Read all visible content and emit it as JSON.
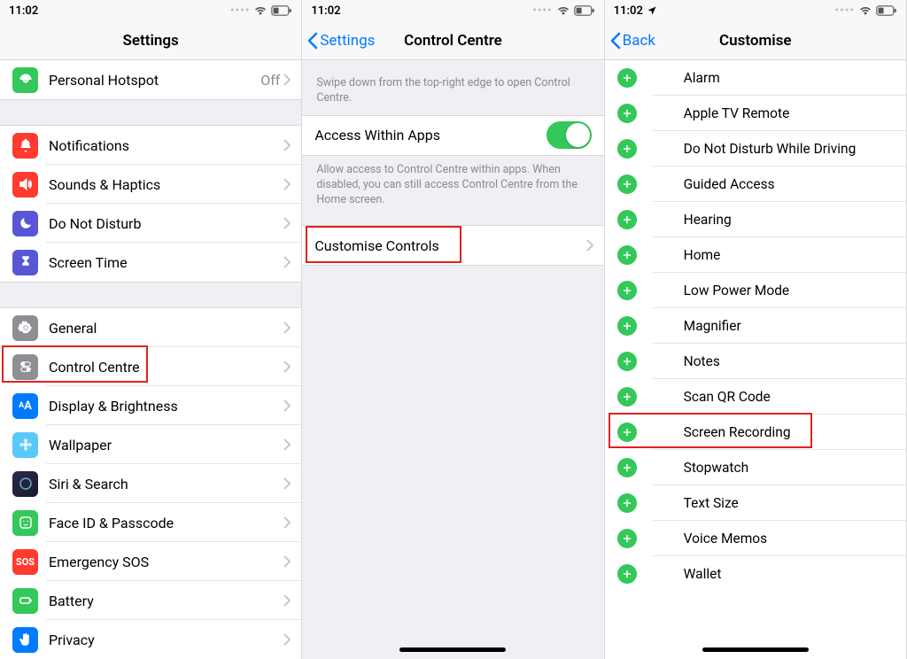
{
  "status": {
    "time": "11:02",
    "locationArrow": "↗"
  },
  "screen1": {
    "title": "Settings",
    "hotspot": {
      "label": "Personal Hotspot",
      "value": "Off"
    },
    "groupA": [
      {
        "label": "Notifications",
        "color": "red",
        "icon": "bell"
      },
      {
        "label": "Sounds & Haptics",
        "color": "red",
        "icon": "speaker"
      },
      {
        "label": "Do Not Disturb",
        "color": "purple",
        "icon": "moon"
      },
      {
        "label": "Screen Time",
        "color": "purple",
        "icon": "hourglass"
      }
    ],
    "groupB": [
      {
        "label": "General",
        "color": "grey",
        "icon": "gear"
      },
      {
        "label": "Control Centre",
        "color": "grey",
        "icon": "switches"
      },
      {
        "label": "Display & Brightness",
        "color": "blue",
        "icon": "aa"
      },
      {
        "label": "Wallpaper",
        "color": "teal",
        "icon": "flower"
      },
      {
        "label": "Siri & Search",
        "color": "siri",
        "icon": "siri"
      },
      {
        "label": "Face ID & Passcode",
        "color": "green",
        "icon": "face"
      },
      {
        "label": "Emergency SOS",
        "color": "sos",
        "icon": "sos"
      },
      {
        "label": "Battery",
        "color": "green",
        "icon": "battery"
      },
      {
        "label": "Privacy",
        "color": "blue",
        "icon": "hand"
      }
    ]
  },
  "screen2": {
    "backLabel": "Settings",
    "title": "Control Centre",
    "headerText": "Swipe down from the top-right edge to open Control Centre.",
    "accessWithinApps": "Access Within Apps",
    "accessFooter": "Allow access to Control Centre within apps. When disabled, you can still access Control Centre from the Home screen.",
    "customiseControls": "Customise Controls"
  },
  "screen3": {
    "backLabel": "Back",
    "title": "Customise",
    "items": [
      {
        "label": "Alarm",
        "color": "orange",
        "icon": "clock"
      },
      {
        "label": "Apple TV Remote",
        "color": "grey",
        "icon": "tv"
      },
      {
        "label": "Do Not Disturb While Driving",
        "color": "blue",
        "icon": "car"
      },
      {
        "label": "Guided Access",
        "color": "darkblue",
        "icon": "lock"
      },
      {
        "label": "Hearing",
        "color": "blue",
        "icon": "ear"
      },
      {
        "label": "Home",
        "color": "orange",
        "icon": "home"
      },
      {
        "label": "Low Power Mode",
        "color": "orange",
        "icon": "battery"
      },
      {
        "label": "Magnifier",
        "color": "blue",
        "icon": "search"
      },
      {
        "label": "Notes",
        "color": "yellow",
        "icon": "note"
      },
      {
        "label": "Scan QR Code",
        "color": "grey",
        "icon": "qr"
      },
      {
        "label": "Screen Recording",
        "color": "red",
        "icon": "record"
      },
      {
        "label": "Stopwatch",
        "color": "orange",
        "icon": "stopwatch"
      },
      {
        "label": "Text Size",
        "color": "blue",
        "icon": "aa"
      },
      {
        "label": "Voice Memos",
        "color": "red",
        "icon": "wave"
      },
      {
        "label": "Wallet",
        "color": "green",
        "icon": "wallet"
      }
    ]
  }
}
